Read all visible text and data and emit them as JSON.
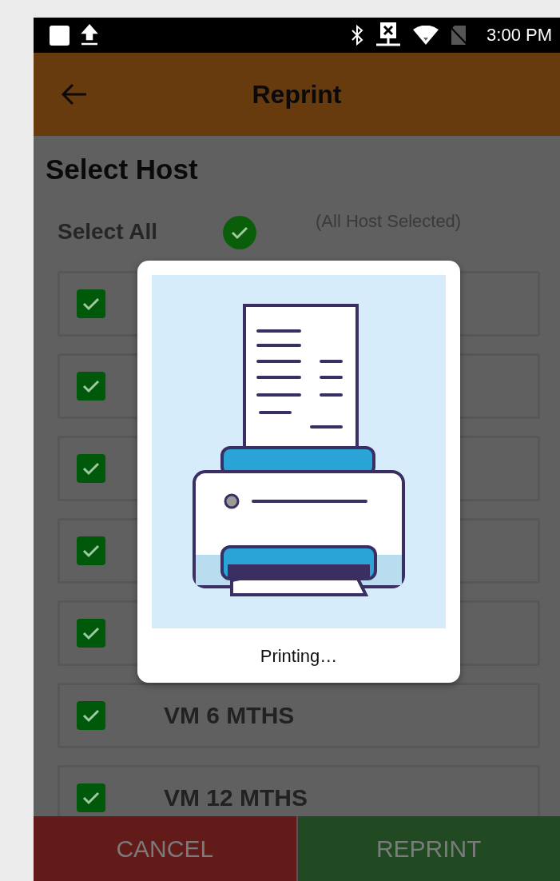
{
  "status_bar": {
    "time": "3:00 PM"
  },
  "app_bar": {
    "title": "Reprint"
  },
  "heading": "Select Host",
  "select_all": {
    "label": "Select All",
    "checked": true,
    "note": "(All Host Selected)"
  },
  "hosts": [
    {
      "checked": true
    },
    {
      "checked": true
    },
    {
      "checked": true
    },
    {
      "checked": true
    },
    {
      "checked": true
    },
    {
      "checked": true,
      "label": "VM 6 MTHS"
    },
    {
      "checked": true,
      "label": "VM 12 MTHS"
    }
  ],
  "dialog": {
    "caption": "Printing…"
  },
  "buttons": [
    {
      "kind": "cancel",
      "label": "CANCEL"
    },
    {
      "kind": "confirm",
      "label": "REPRINT"
    }
  ]
}
